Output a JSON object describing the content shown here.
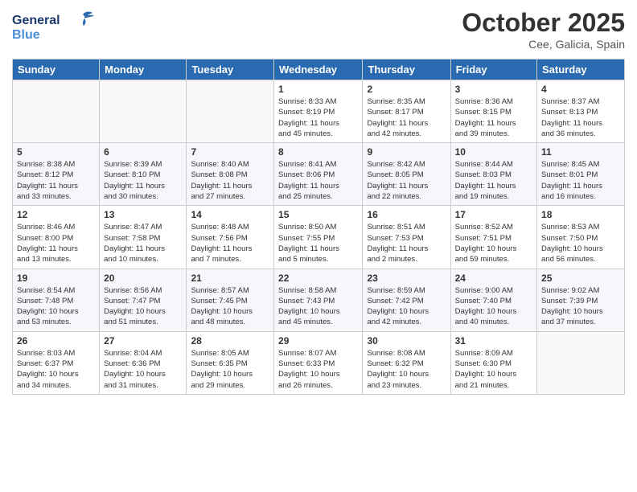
{
  "header": {
    "logo_line1": "General",
    "logo_line2": "Blue",
    "month": "October 2025",
    "location": "Cee, Galicia, Spain"
  },
  "days_of_week": [
    "Sunday",
    "Monday",
    "Tuesday",
    "Wednesday",
    "Thursday",
    "Friday",
    "Saturday"
  ],
  "weeks": [
    [
      {
        "num": "",
        "info": ""
      },
      {
        "num": "",
        "info": ""
      },
      {
        "num": "",
        "info": ""
      },
      {
        "num": "1",
        "info": "Sunrise: 8:33 AM\nSunset: 8:19 PM\nDaylight: 11 hours\nand 45 minutes."
      },
      {
        "num": "2",
        "info": "Sunrise: 8:35 AM\nSunset: 8:17 PM\nDaylight: 11 hours\nand 42 minutes."
      },
      {
        "num": "3",
        "info": "Sunrise: 8:36 AM\nSunset: 8:15 PM\nDaylight: 11 hours\nand 39 minutes."
      },
      {
        "num": "4",
        "info": "Sunrise: 8:37 AM\nSunset: 8:13 PM\nDaylight: 11 hours\nand 36 minutes."
      }
    ],
    [
      {
        "num": "5",
        "info": "Sunrise: 8:38 AM\nSunset: 8:12 PM\nDaylight: 11 hours\nand 33 minutes."
      },
      {
        "num": "6",
        "info": "Sunrise: 8:39 AM\nSunset: 8:10 PM\nDaylight: 11 hours\nand 30 minutes."
      },
      {
        "num": "7",
        "info": "Sunrise: 8:40 AM\nSunset: 8:08 PM\nDaylight: 11 hours\nand 27 minutes."
      },
      {
        "num": "8",
        "info": "Sunrise: 8:41 AM\nSunset: 8:06 PM\nDaylight: 11 hours\nand 25 minutes."
      },
      {
        "num": "9",
        "info": "Sunrise: 8:42 AM\nSunset: 8:05 PM\nDaylight: 11 hours\nand 22 minutes."
      },
      {
        "num": "10",
        "info": "Sunrise: 8:44 AM\nSunset: 8:03 PM\nDaylight: 11 hours\nand 19 minutes."
      },
      {
        "num": "11",
        "info": "Sunrise: 8:45 AM\nSunset: 8:01 PM\nDaylight: 11 hours\nand 16 minutes."
      }
    ],
    [
      {
        "num": "12",
        "info": "Sunrise: 8:46 AM\nSunset: 8:00 PM\nDaylight: 11 hours\nand 13 minutes."
      },
      {
        "num": "13",
        "info": "Sunrise: 8:47 AM\nSunset: 7:58 PM\nDaylight: 11 hours\nand 10 minutes."
      },
      {
        "num": "14",
        "info": "Sunrise: 8:48 AM\nSunset: 7:56 PM\nDaylight: 11 hours\nand 7 minutes."
      },
      {
        "num": "15",
        "info": "Sunrise: 8:50 AM\nSunset: 7:55 PM\nDaylight: 11 hours\nand 5 minutes."
      },
      {
        "num": "16",
        "info": "Sunrise: 8:51 AM\nSunset: 7:53 PM\nDaylight: 11 hours\nand 2 minutes."
      },
      {
        "num": "17",
        "info": "Sunrise: 8:52 AM\nSunset: 7:51 PM\nDaylight: 10 hours\nand 59 minutes."
      },
      {
        "num": "18",
        "info": "Sunrise: 8:53 AM\nSunset: 7:50 PM\nDaylight: 10 hours\nand 56 minutes."
      }
    ],
    [
      {
        "num": "19",
        "info": "Sunrise: 8:54 AM\nSunset: 7:48 PM\nDaylight: 10 hours\nand 53 minutes."
      },
      {
        "num": "20",
        "info": "Sunrise: 8:56 AM\nSunset: 7:47 PM\nDaylight: 10 hours\nand 51 minutes."
      },
      {
        "num": "21",
        "info": "Sunrise: 8:57 AM\nSunset: 7:45 PM\nDaylight: 10 hours\nand 48 minutes."
      },
      {
        "num": "22",
        "info": "Sunrise: 8:58 AM\nSunset: 7:43 PM\nDaylight: 10 hours\nand 45 minutes."
      },
      {
        "num": "23",
        "info": "Sunrise: 8:59 AM\nSunset: 7:42 PM\nDaylight: 10 hours\nand 42 minutes."
      },
      {
        "num": "24",
        "info": "Sunrise: 9:00 AM\nSunset: 7:40 PM\nDaylight: 10 hours\nand 40 minutes."
      },
      {
        "num": "25",
        "info": "Sunrise: 9:02 AM\nSunset: 7:39 PM\nDaylight: 10 hours\nand 37 minutes."
      }
    ],
    [
      {
        "num": "26",
        "info": "Sunrise: 8:03 AM\nSunset: 6:37 PM\nDaylight: 10 hours\nand 34 minutes."
      },
      {
        "num": "27",
        "info": "Sunrise: 8:04 AM\nSunset: 6:36 PM\nDaylight: 10 hours\nand 31 minutes."
      },
      {
        "num": "28",
        "info": "Sunrise: 8:05 AM\nSunset: 6:35 PM\nDaylight: 10 hours\nand 29 minutes."
      },
      {
        "num": "29",
        "info": "Sunrise: 8:07 AM\nSunset: 6:33 PM\nDaylight: 10 hours\nand 26 minutes."
      },
      {
        "num": "30",
        "info": "Sunrise: 8:08 AM\nSunset: 6:32 PM\nDaylight: 10 hours\nand 23 minutes."
      },
      {
        "num": "31",
        "info": "Sunrise: 8:09 AM\nSunset: 6:30 PM\nDaylight: 10 hours\nand 21 minutes."
      },
      {
        "num": "",
        "info": ""
      }
    ]
  ]
}
